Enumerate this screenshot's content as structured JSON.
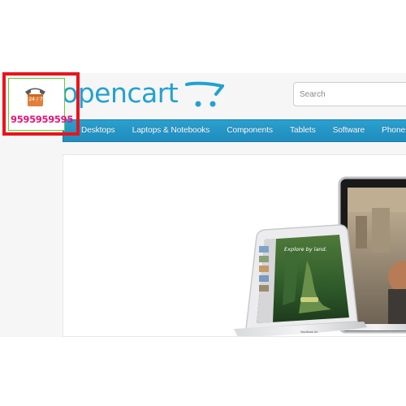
{
  "header": {
    "logo_text": "opencart",
    "search_placeholder": "Search"
  },
  "nav": {
    "items": [
      {
        "label": "Desktops"
      },
      {
        "label": "Laptops & Notebooks"
      },
      {
        "label": "Components"
      },
      {
        "label": "Tablets"
      },
      {
        "label": "Software"
      },
      {
        "label": "Phones & PDAs"
      }
    ]
  },
  "support_widget": {
    "badge": "24 / 7",
    "phone_number": "9595959595",
    "icon": "telephone-icon",
    "colors": {
      "border": "#e8141d",
      "inner_border": "#66cc33",
      "number": "#e8147a",
      "phone": "#e0803a"
    }
  },
  "slideshow": {
    "screen_title": "Explore by land.",
    "device_label": "MacBook Air"
  },
  "colors": {
    "brand": "#23a1d1",
    "nav_bg": "#229ac8"
  }
}
